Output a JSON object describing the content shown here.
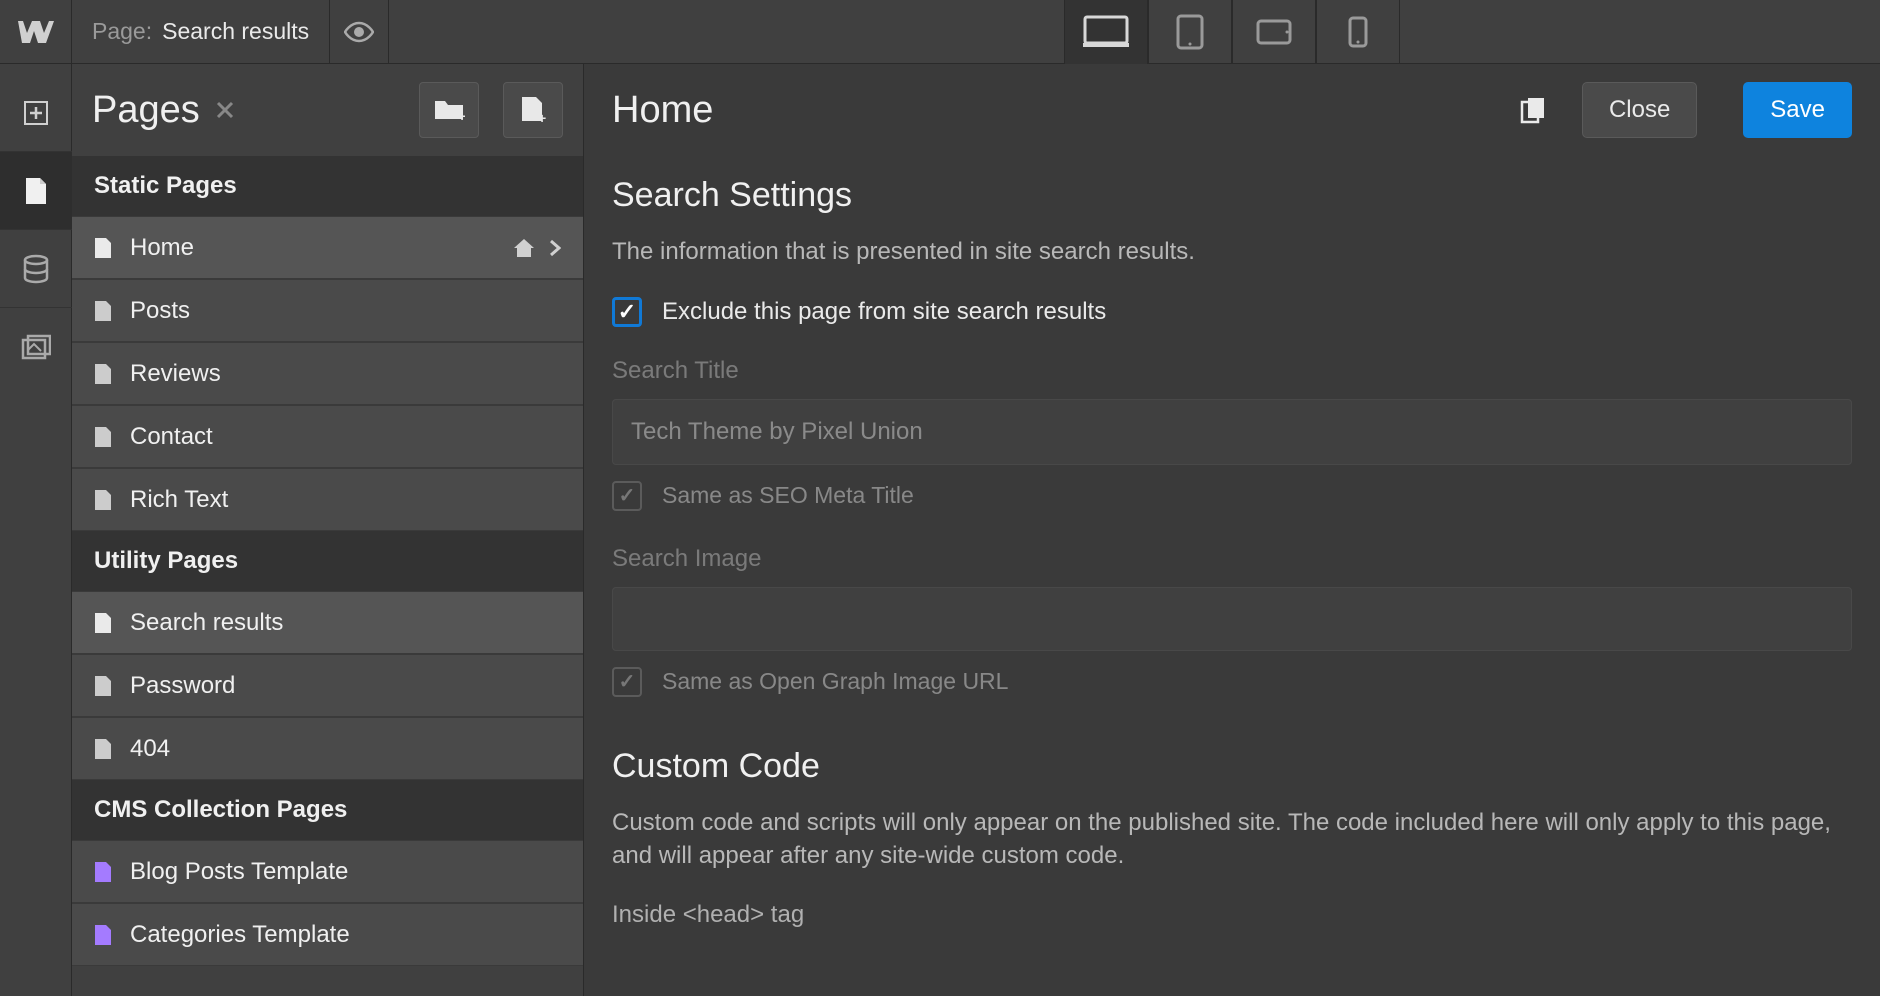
{
  "topbar": {
    "page_prefix": "Page:",
    "page_name": "Search results"
  },
  "sidebar": {
    "title": "Pages",
    "sections": {
      "static": {
        "title": "Static Pages",
        "items": [
          {
            "label": "Home"
          },
          {
            "label": "Posts"
          },
          {
            "label": "Reviews"
          },
          {
            "label": "Contact"
          },
          {
            "label": "Rich Text"
          }
        ]
      },
      "utility": {
        "title": "Utility Pages",
        "items": [
          {
            "label": "Search results"
          },
          {
            "label": "Password"
          },
          {
            "label": "404"
          }
        ]
      },
      "cms": {
        "title": "CMS Collection Pages",
        "items": [
          {
            "label": "Blog Posts Template"
          },
          {
            "label": "Categories Template"
          }
        ]
      }
    }
  },
  "panel": {
    "title": "Home",
    "close": "Close",
    "save": "Save",
    "search_settings": {
      "heading": "Search Settings",
      "desc": "The information that is presented in site search results.",
      "exclude_label": "Exclude this page from site search results",
      "search_title_label": "Search Title",
      "search_title_value": "Tech Theme by Pixel Union",
      "same_seo_label": "Same as SEO Meta Title",
      "search_image_label": "Search Image",
      "same_og_label": "Same as Open Graph Image URL"
    },
    "custom_code": {
      "heading": "Custom Code",
      "desc": "Custom code and scripts will only appear on the published site. The code included here will only apply to this page, and will appear after any site-wide custom code.",
      "head_label": "Inside <head> tag"
    }
  }
}
